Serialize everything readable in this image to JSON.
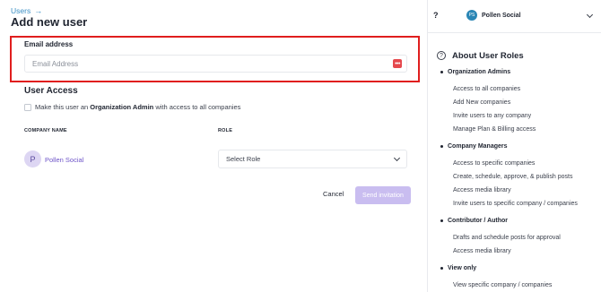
{
  "breadcrumb": {
    "parent": "Users",
    "arrow": "→"
  },
  "page": {
    "title": "Add new user"
  },
  "email": {
    "label": "Email address",
    "placeholder": "Email Address",
    "value": ""
  },
  "access": {
    "title": "User Access",
    "admin_prefix": "Make this user an ",
    "admin_bold": "Organization Admin",
    "admin_suffix": " with access to all companies",
    "checked": false
  },
  "table": {
    "col_company": "COMPANY NAME",
    "col_role": "ROLE",
    "rows": [
      {
        "avatar_letter": "P",
        "company": "Pollen Social",
        "role": "Select Role"
      }
    ]
  },
  "actions": {
    "cancel": "Cancel",
    "send": "Send invitation"
  },
  "topbar": {
    "help": "?",
    "workspace_initials": "PS",
    "workspace_name": "Pollen Social"
  },
  "about": {
    "icon": "?",
    "title": "About User Roles",
    "groups": [
      {
        "name": "Organization Admins",
        "items": [
          "Access to all companies",
          "Add New companies",
          "Invite users to any company",
          "Manage Plan & Billing access"
        ]
      },
      {
        "name": "Company Managers",
        "items": [
          "Access to specific companies",
          "Create, schedule, approve, & publish posts",
          "Access media library",
          "Invite users to specific company / companies"
        ]
      },
      {
        "name": "Contributor / Author",
        "items": [
          "Drafts and schedule posts for approval",
          "Access media library"
        ]
      },
      {
        "name": "View only",
        "items": [
          "View specific company / companies"
        ]
      }
    ]
  },
  "colors": {
    "accent": "#6e54c8",
    "highlight_border": "#e01e1e",
    "send_button": "#c9bdf0",
    "link": "#3b8fc4"
  }
}
